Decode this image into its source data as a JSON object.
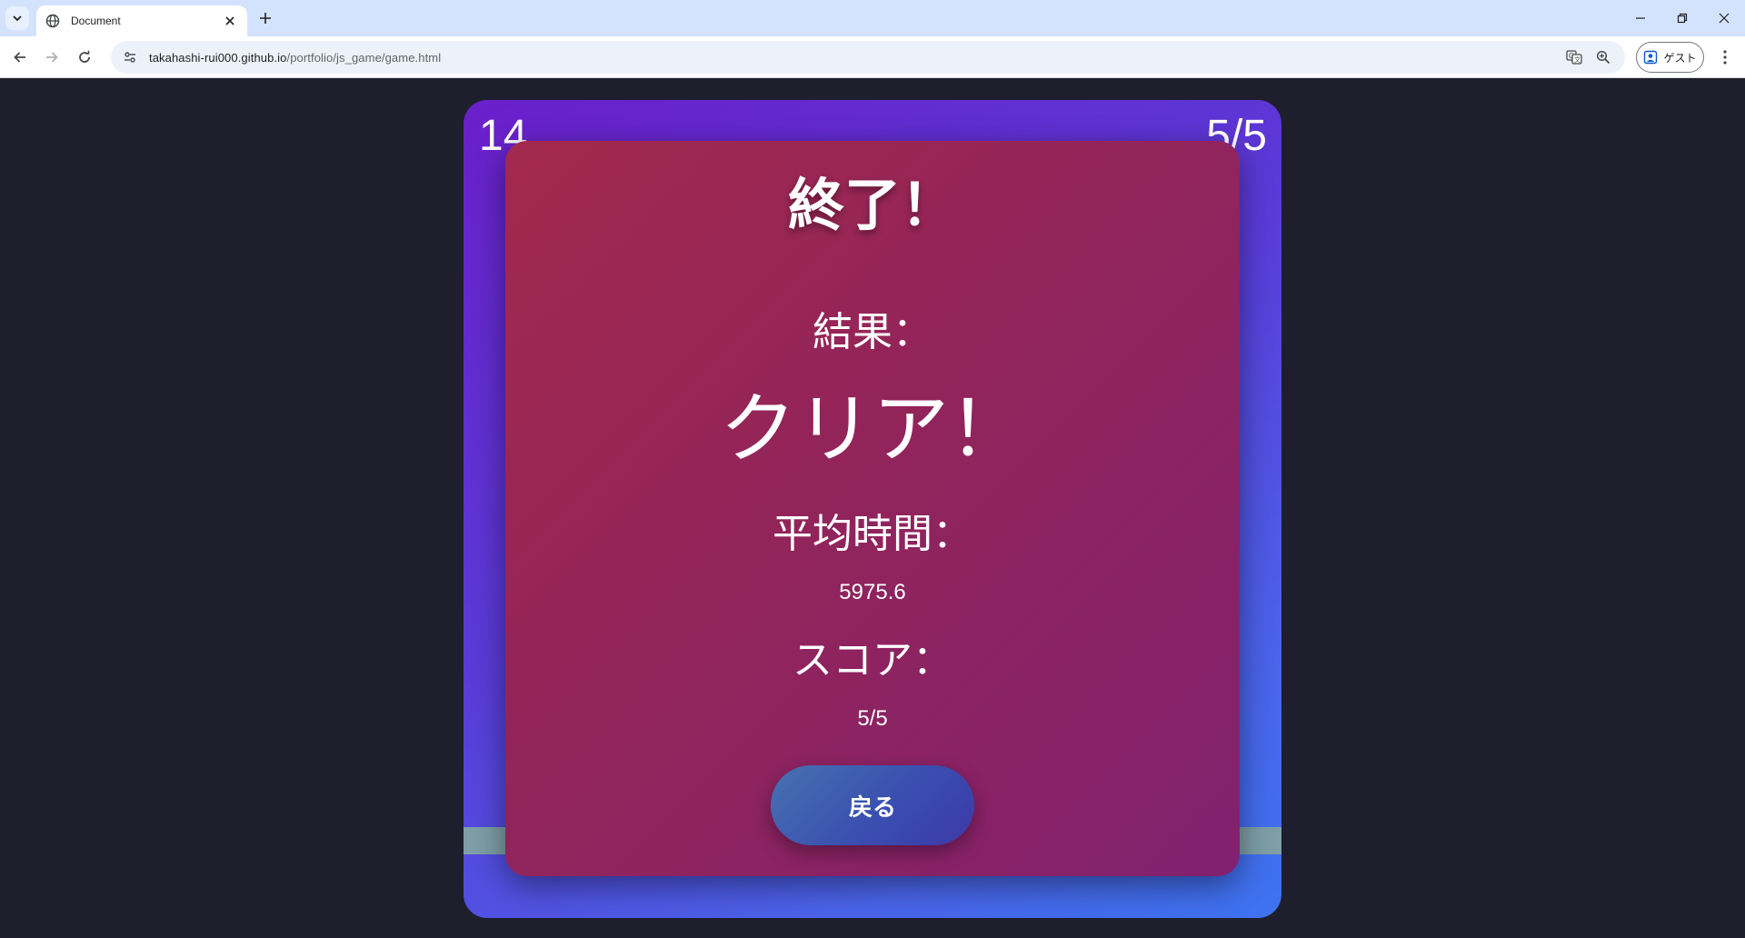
{
  "browser": {
    "tab_title": "Document",
    "url_host": "takahashi-rui000.github.io",
    "url_path": "/portfolio/js_game/game.html",
    "profile_label": "ゲスト"
  },
  "game": {
    "timer": "14",
    "progress": "5/5",
    "colors": {
      "page_background": "#1e1e2d",
      "board_gradient_start": "#6a1fca",
      "board_gradient_end": "#3d73f0",
      "panel_gradient_start": "#a3294d",
      "panel_gradient_end": "#822170",
      "ground_strip": "#7e9fa6",
      "button_gradient_start": "#4772b0",
      "button_gradient_end": "#3c39a8"
    }
  },
  "result_panel": {
    "title": "終了！",
    "result_label": "結果：",
    "result_value": "クリア！",
    "avg_time_label": "平均時間：",
    "avg_time_value": "5975.6",
    "score_label": "スコア：",
    "score_value": "5/5",
    "back_button_label": "戻る"
  },
  "icons": {
    "tab_list": "chevron-down-icon",
    "favicon": "globe-icon",
    "tab_close": "close-icon",
    "new_tab": "plus-icon",
    "back": "arrow-left-icon",
    "forward": "arrow-right-icon",
    "reload": "reload-icon",
    "site_info": "tune-icon",
    "translate": "translate-icon",
    "zoom": "zoom-in-icon",
    "profile": "person-icon",
    "menu": "kebab-menu-icon"
  }
}
